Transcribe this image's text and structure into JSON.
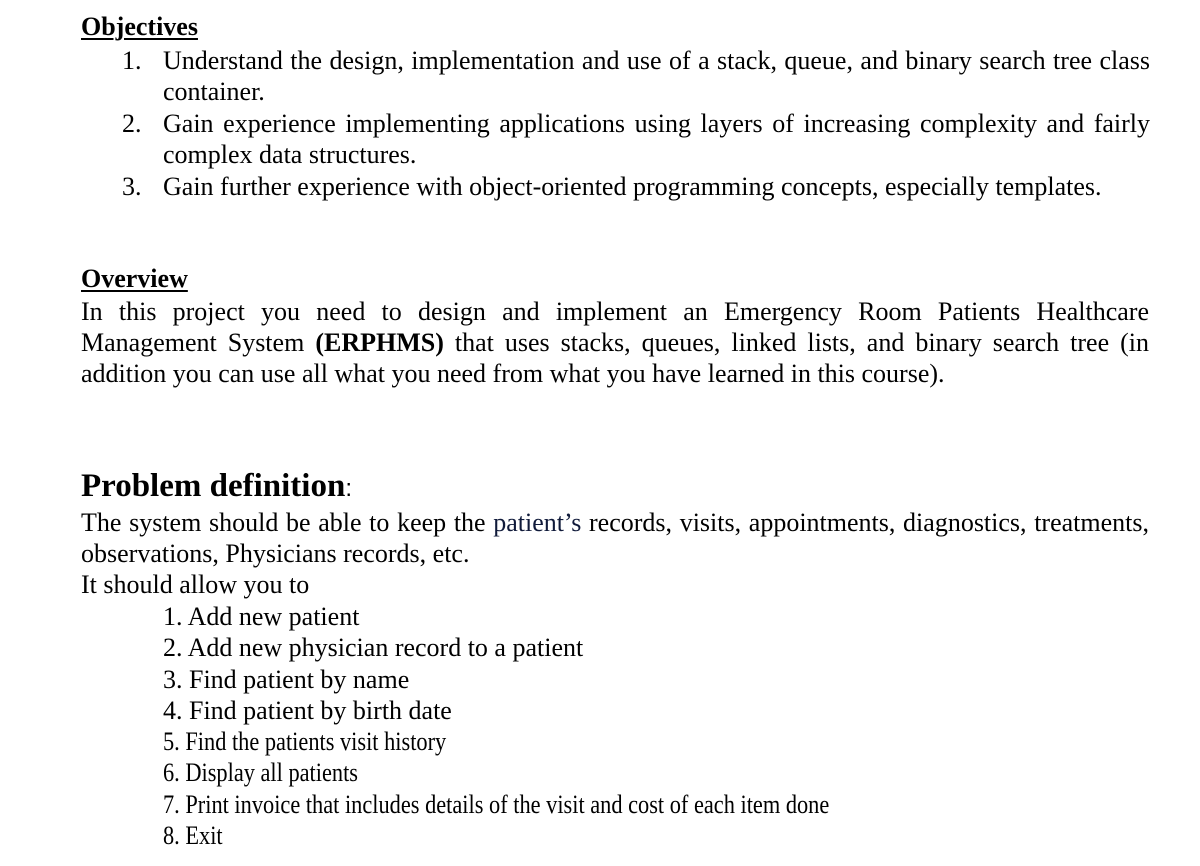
{
  "objectives": {
    "heading": "Objectives",
    "items": [
      {
        "number": "1.",
        "text": "Understand the design, implementation and use of a stack, queue, and binary search tree class container."
      },
      {
        "number": "2.",
        "text": "Gain experience implementing applications using layers of increasing complexity and fairly complex data structures."
      },
      {
        "number": "3.",
        "text": "Gain further experience with object-oriented programming concepts, especially templates."
      }
    ]
  },
  "overview": {
    "heading": "Overview",
    "text_before": "In this project you need to design and implement an Emergency Room Patients Healthcare Management System ",
    "acronym": "(ERPHMS)",
    "text_after": " that uses stacks, queues, linked lists, and binary search tree (in addition you can use all what you need from what you have learned in this course)."
  },
  "problem_definition": {
    "heading": "Problem definition",
    "heading_suffix": ":",
    "text_before": "The system should be able to keep the ",
    "highlighted_word": "patient’s",
    "text_after": " records, visits, appointments, diagnostics, treatments, observations, Physicians records, etc.",
    "intro": "It should allow you to",
    "features": [
      {
        "number": "1.",
        "text": "Add new patient"
      },
      {
        "number": "2.",
        "text": "Add new physician record to a patient"
      },
      {
        "number": "3.",
        "text": "Find patient by name"
      },
      {
        "number": "4.",
        "text": "Find patient by birth date"
      },
      {
        "number": "5.",
        "text": "Find the patients visit history"
      },
      {
        "number": "6.",
        "text": "Display all patients"
      },
      {
        "number": "7.",
        "text": "Print invoice that includes details of the visit and cost of each item done"
      },
      {
        "number": "8.",
        "text": "Exit"
      }
    ]
  },
  "colors": {
    "text": "#000000",
    "highlighted_word": "#101a3a",
    "background": "#ffffff"
  }
}
